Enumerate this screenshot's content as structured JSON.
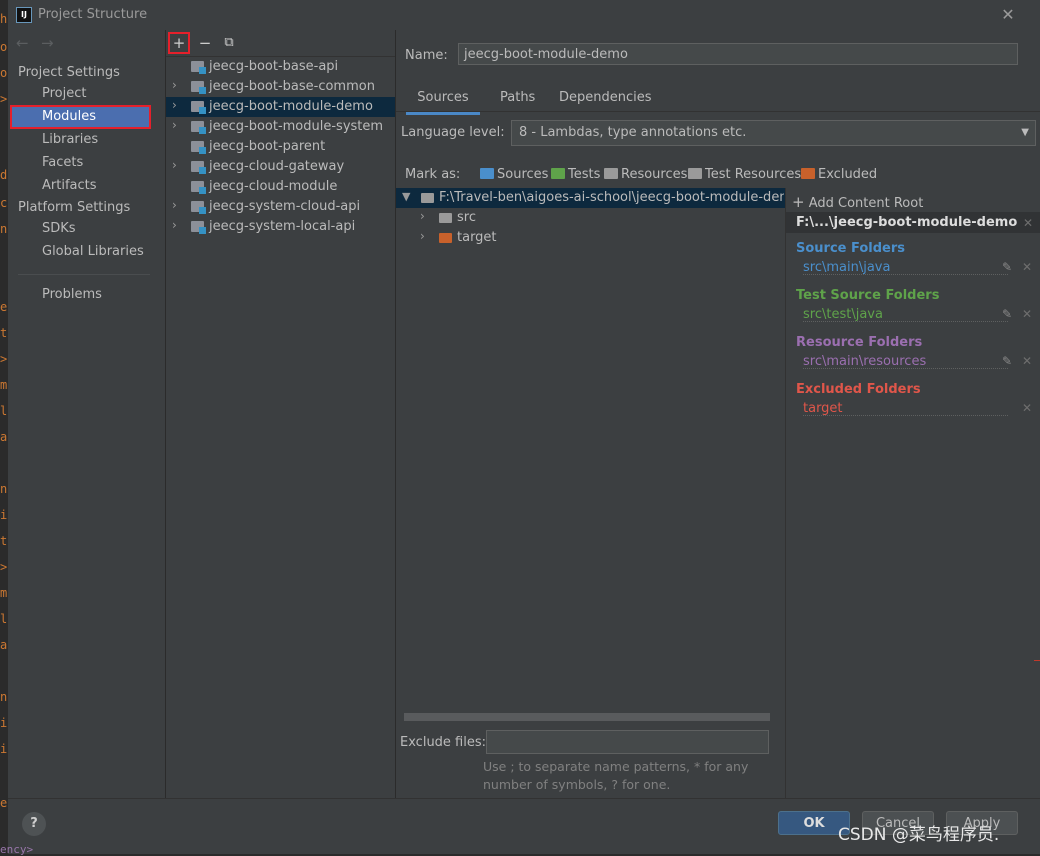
{
  "window": {
    "title": "Project Structure",
    "app_icon": "IJ"
  },
  "background_editor": {
    "chars": [
      "h",
      "o",
      "o",
      ">",
      "d",
      "c",
      "n",
      "e",
      "t",
      ">",
      "m",
      "l",
      "a",
      "n",
      "i",
      "t",
      ">",
      "m",
      "l",
      "a",
      "n",
      "i",
      "i",
      "e"
    ],
    "bottom_text": "ency>"
  },
  "nav": {
    "back_icon": "←",
    "forward_icon": "→",
    "project_settings_header": "Project Settings",
    "project_settings_items": [
      "Project",
      "Modules",
      "Libraries",
      "Facets",
      "Artifacts"
    ],
    "platform_settings_header": "Platform Settings",
    "platform_settings_items": [
      "SDKs",
      "Global Libraries"
    ],
    "other_items": [
      "Problems"
    ],
    "selected": "Modules"
  },
  "modules_toolbar": {
    "add": "+",
    "remove": "−",
    "copy": "⧉"
  },
  "modules": [
    {
      "name": "jeecg-boot-base-api",
      "expandable": false
    },
    {
      "name": "jeecg-boot-base-common",
      "expandable": true
    },
    {
      "name": "jeecg-boot-module-demo",
      "expandable": true,
      "selected": true
    },
    {
      "name": "jeecg-boot-module-system",
      "expandable": true
    },
    {
      "name": "jeecg-boot-parent",
      "expandable": false
    },
    {
      "name": "jeecg-cloud-gateway",
      "expandable": true
    },
    {
      "name": "jeecg-cloud-module",
      "expandable": false
    },
    {
      "name": "jeecg-system-cloud-api",
      "expandable": true
    },
    {
      "name": "jeecg-system-local-api",
      "expandable": true
    }
  ],
  "detail": {
    "name_label": "Name:",
    "name_value": "jeecg-boot-module-demo",
    "tabs": [
      "Sources",
      "Paths",
      "Dependencies"
    ],
    "active_tab": "Sources",
    "language_level_label": "Language level:",
    "language_level_value": "8 - Lambdas, type annotations etc.",
    "mark_as_label": "Mark as:",
    "mark_as": [
      {
        "label": "Sources",
        "color": "#4a8fcc"
      },
      {
        "label": "Tests",
        "color": "#5fa34a"
      },
      {
        "label": "Resources",
        "color": "#9a9a9a"
      },
      {
        "label": "Test Resources",
        "color": "#9a9a9a"
      },
      {
        "label": "Excluded",
        "color": "#c8612b"
      }
    ],
    "tree": {
      "root": "F:\\Travel-ben\\aigoes-ai-school\\jeecg-boot-module-demo",
      "children": [
        {
          "name": "src",
          "color": "#9a9a9a"
        },
        {
          "name": "target",
          "color": "#c8612b"
        }
      ]
    },
    "exclude_files_label": "Exclude files:",
    "exclude_files_value": "",
    "hint_line1": "Use ; to separate name patterns, * for any",
    "hint_line2": "number of symbols, ? for one."
  },
  "content_root": {
    "add_label": "Add Content Root",
    "path": "F:\\...\\jeecg-boot-module-demo",
    "groups": [
      {
        "title": "Source Folders",
        "path": "src\\main\\java",
        "color": "#4a8fcc",
        "editable": true
      },
      {
        "title": "Test Source Folders",
        "path": "src\\test\\java",
        "color": "#5fa34a",
        "editable": true
      },
      {
        "title": "Resource Folders",
        "path": "src\\main\\resources",
        "color": "#9b6fb0",
        "editable": true
      },
      {
        "title": "Excluded Folders",
        "path": "target",
        "color": "#e0564a",
        "editable": false
      }
    ]
  },
  "buttons": {
    "ok": "OK",
    "cancel": "Cancel",
    "apply": "Apply",
    "help": "?"
  },
  "watermark": "CSDN @菜鸟程序员."
}
